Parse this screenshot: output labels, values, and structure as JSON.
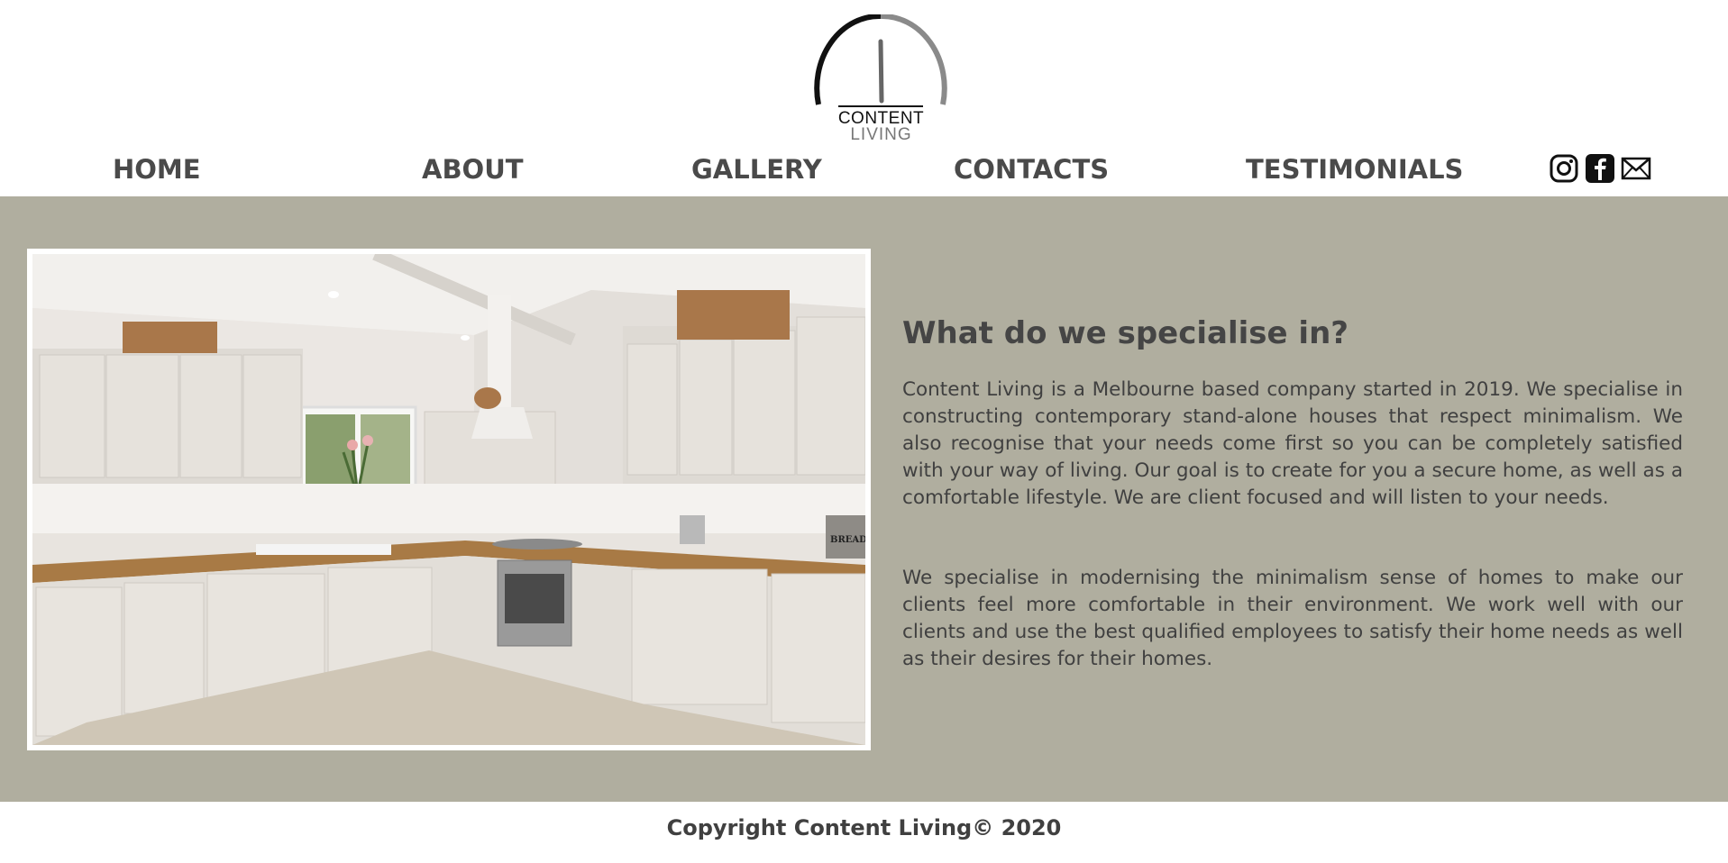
{
  "brand": {
    "logo_line1": "CONTENT",
    "logo_line2": "LIVING"
  },
  "nav": {
    "home": "HOME",
    "about": "ABOUT",
    "gallery": "GALLERY",
    "contacts": "CONTACTS",
    "testimonials": "TESTIMONIALS"
  },
  "social": [
    "instagram-icon",
    "facebook-icon",
    "mail-icon"
  ],
  "main": {
    "heading": "What do we specialise in?",
    "paragraph1": "Content Living is a Melbourne based company started in 2019. We specialise in constructing contemporary stand-alone houses that respect minimalism. We also recognise that your needs come first so you can be completely satisfied with your way of living. Our goal is to create for you a secure home, as well as a comfortable lifestyle. We are client focused and will listen to your needs.",
    "paragraph2": "We specialise in modernising the minimalism sense of homes to make our clients feel more comfortable in their environment. We work well with our clients and use the best qualified employees to satisfy their home needs as well as their desires for their homes.",
    "photo_label": "BREAD"
  },
  "footer": {
    "copyright": "Copyright Content Living© 2020"
  },
  "colors": {
    "main_bg": "#b0ae9f",
    "text": "#4a4a4a",
    "white": "#ffffff"
  }
}
